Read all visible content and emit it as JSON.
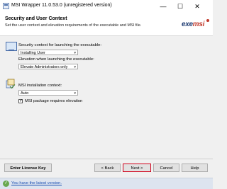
{
  "window": {
    "title": "MSI Wrapper 11.0.53.0 (unregistered version)",
    "minimize": "—",
    "maximize": "☐",
    "close": "✕"
  },
  "header": {
    "title": "Security and User Context",
    "description": "Set the user context and elevation requirements of the executable and MSI file.",
    "brand_main": "exe",
    "brand_accent": "msi"
  },
  "security": {
    "icon": "monitor-icon",
    "context_label": "Security context for launching the executable:",
    "context_value": "Installing User",
    "elevation_label": "Elevation when launching the executable:",
    "elevation_value": "Elevate Administrators only"
  },
  "msi": {
    "icon": "msi-package-icon",
    "context_label": "MSI installation context:",
    "context_value": "Auto",
    "elevation_checkbox_label": "MSI package requires elevation",
    "elevation_checked": true
  },
  "buttons": {
    "license": "Enter License Key",
    "back": "< Back",
    "next": "Next >",
    "cancel": "Cancel",
    "help": "Help"
  },
  "status": {
    "message": "You have the latest version.",
    "icon": "check-circle-icon",
    "accent": "#6aa84f"
  },
  "colors": {
    "next_border": "#d0021b",
    "brand_blue": "#1f3c73",
    "brand_red": "#c0392b"
  }
}
